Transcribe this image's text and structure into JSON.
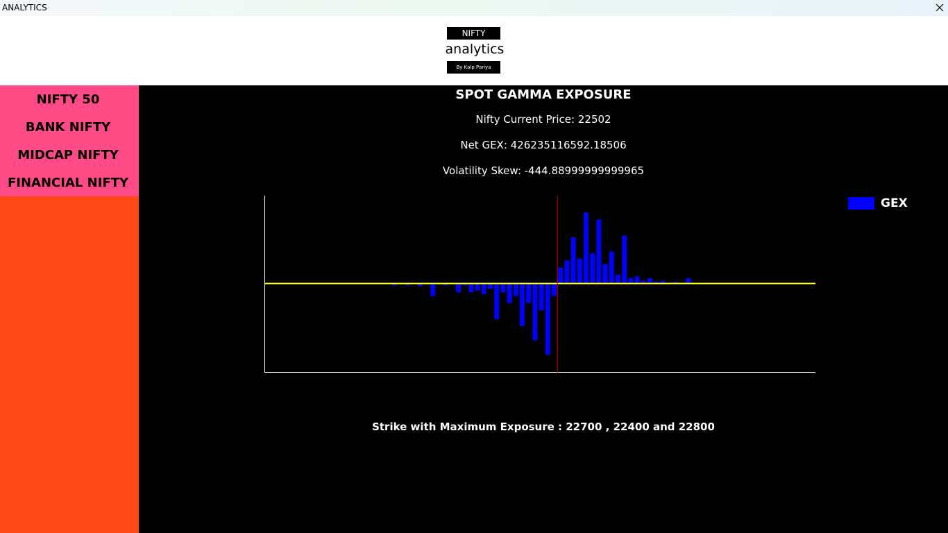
{
  "window": {
    "title": "ANALYTICS"
  },
  "logo": {
    "top": "NIFTY",
    "word": "analytics",
    "byline": "By Kalp Pariya"
  },
  "sidebar": {
    "items": [
      {
        "label": "NIFTY 50"
      },
      {
        "label": "BANK NIFTY"
      },
      {
        "label": "MIDCAP NIFTY"
      },
      {
        "label": "FINANCIAL NIFTY"
      }
    ]
  },
  "main": {
    "heading": "SPOT GAMMA EXPOSURE",
    "current_price": "Nifty Current Price: 22502",
    "net_gex": "Net GEX: 426235116592.18506",
    "vol_skew": "Volatility Skew: -444.88999999999965",
    "max_exposure": "Strike with Maximum Exposure : 22700 , 22400 and 22800"
  },
  "colors": {
    "sidebar_nav_bg": "#ff4a86",
    "sidebar_bg": "#ff4916",
    "bar": "#0000ff",
    "zero_line": "#ffff00",
    "spot_line": "#cc0000"
  },
  "chart_data": {
    "type": "bar",
    "title": "",
    "legend": {
      "entries": [
        "GEX"
      ],
      "placement": "top-right"
    },
    "series": [
      {
        "name": "GEX",
        "values": [
          0,
          0,
          0,
          0,
          0,
          0,
          0,
          0,
          0,
          0,
          0,
          0,
          0,
          0,
          0,
          0,
          0,
          0,
          0,
          0,
          -2,
          0,
          -2,
          0,
          -3,
          0,
          -14,
          0,
          -2,
          0,
          -10,
          -2,
          -10,
          -8,
          -12,
          -6,
          -40,
          -10,
          -22,
          -14,
          -48,
          -22,
          -64,
          -30,
          -80,
          -14,
          18,
          26,
          52,
          28,
          80,
          34,
          72,
          22,
          36,
          10,
          54,
          6,
          8,
          3,
          6,
          2,
          3,
          1,
          2,
          0,
          6,
          0,
          0,
          0,
          0,
          0,
          0,
          0,
          0,
          0,
          0,
          0,
          0,
          0,
          0,
          0
        ]
      }
    ],
    "spot_index": 46,
    "grid": false
  }
}
